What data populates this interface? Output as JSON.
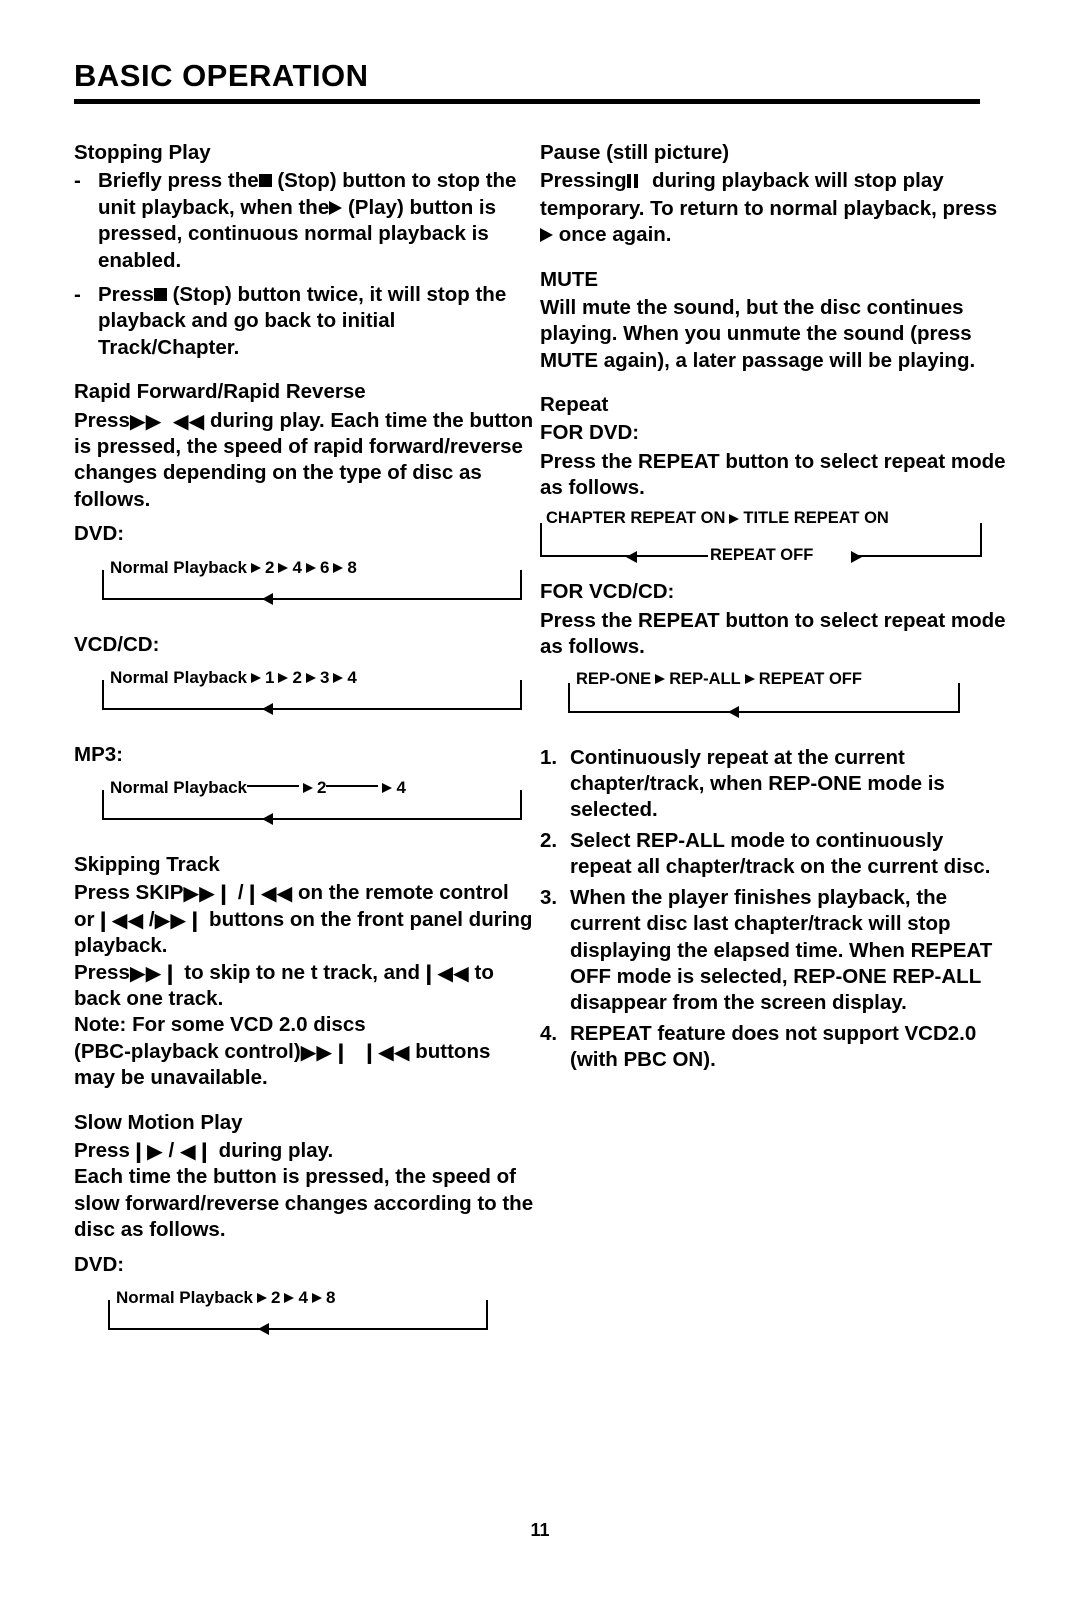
{
  "header": {
    "title": "BASIC OPERATION"
  },
  "left": {
    "stopping": {
      "heading": "Stopping Play",
      "item1_pre": "Briefly press the",
      "item1_mid": "(Stop) button to stop the unit playback, when the",
      "item1_post": "(Play) button is pressed, continuous normal playback is enabled.",
      "item2_pre": "Press",
      "item2_post": "(Stop) button twice, it will stop the playback and go back to initial Track/Chapter.",
      "bullet": "-"
    },
    "rapid": {
      "heading": "Rapid Forward/Rapid Reverse",
      "press": "Press",
      "body": "during play.  Each time the button is pressed, the speed of rapid forward/reverse changes depending on the type of disc as follows."
    },
    "dvd_label": "DVD:",
    "vcdcd_label": "VCD/CD:",
    "mp3_label": "MP3:",
    "skipping": {
      "heading": "Skipping Track",
      "line1a": "Press SKIP",
      "line1b": "/",
      "line1c": "on the remote control",
      "line2a": "or",
      "line2b": "/",
      "line2c": "buttons on the front panel during playback.",
      "line3a": "Press",
      "line3b": "to skip to ne  t track, and",
      "line3c": "to back one track.",
      "note1": "Note:  For some VCD 2.0 discs",
      "note2a": "(PBC-playback control)",
      "note2b": "buttons may be unavailable."
    },
    "slow": {
      "heading": "Slow Motion Play",
      "press": "Press",
      "during": "during play.",
      "body": "Each time the button is pressed, the speed of slow forward/reverse changes according to the disc as follows."
    },
    "dvd_label2": "DVD:"
  },
  "right": {
    "pause": {
      "heading": "Pause (still picture)",
      "line1a": "Pressing",
      "line1b": "during playback will stop play temporary.  To return to normal playback, press",
      "line1c": "once again."
    },
    "mute": {
      "heading": "MUTE",
      "body": "Will mute the sound, but the disc continues playing. When you unmute the sound (press MUTE again), a later passage will be playing."
    },
    "repeat": {
      "heading": "Repeat",
      "for_dvd": "FOR DVD:",
      "dvd_body": "Press the REPEAT button to select repeat mode as follows.",
      "for_vcdcd": "FOR VCD/CD:",
      "vcdcd_body": "Press the REPEAT button to select repeat mode as follows."
    },
    "list": [
      "Continuously repeat at the current chapter/track, when REP-ONE mode is selected.",
      "Select REP-ALL mode to continuously repeat all chapter/track on the current disc.",
      "When the player finishes playback, the current disc last chapter/track will stop displaying the elapsed time. When REPEAT OFF mode is selected, REP-ONE    REP-ALL disappear from the screen display.",
      "REPEAT feature does not support VCD2.0 (with PBC ON)."
    ],
    "list_numbers": [
      "1.",
      "2.",
      "3.",
      "4."
    ]
  },
  "diagrams": {
    "dvd_rapid": {
      "start": "Normal Playback",
      "steps": [
        "2",
        "4",
        "6",
        "8"
      ]
    },
    "vcdcd_rapid": {
      "start": "Normal Playback",
      "steps": [
        "1",
        "2",
        "3",
        "4"
      ]
    },
    "mp3_rapid": {
      "start": "Normal Playback",
      "steps": [
        "2",
        "4"
      ]
    },
    "dvd_slow": {
      "start": "Normal Playback",
      "steps": [
        "2",
        "4",
        "8"
      ]
    },
    "dvd_repeat": {
      "step1": "CHAPTER REPEAT ON",
      "step2": "TITLE REPEAT ON",
      "step3": "REPEAT OFF"
    },
    "vcdcd_repeat": {
      "step1": "REP-ONE",
      "step2": "REP-ALL",
      "step3": "REPEAT OFF"
    }
  },
  "footer": {
    "page_number": "11"
  }
}
